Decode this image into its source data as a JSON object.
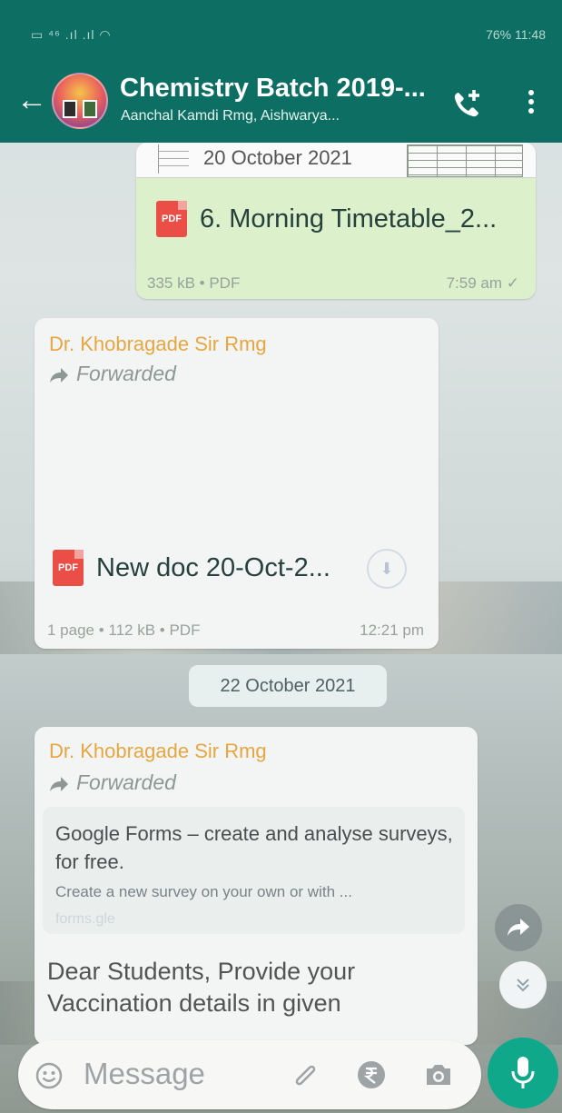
{
  "status_bar": {
    "left": "▭ ⁴⁶ .ıl .ıl ◠",
    "right": "76% 11:48"
  },
  "header": {
    "title": "Chemistry Batch 2019-...",
    "subtitle": "Aanchal Kamdi Rmg, Aishwarya..."
  },
  "messages": [
    {
      "type": "document",
      "direction": "outgoing",
      "thumbnail_text": "20 October 2021",
      "file_icon": "PDF",
      "file_name": "6. Morning Timetable_2...",
      "meta": "335 kB • PDF",
      "time": "7:59 am ✓"
    },
    {
      "type": "document",
      "direction": "incoming",
      "sender": "Dr. Khobragade Sir Rmg",
      "forwarded_label": "Forwarded",
      "file_icon": "PDF",
      "file_name": "New doc 20-Oct-2...",
      "meta": "1 page • 112 kB • PDF",
      "time": "12:21 pm"
    },
    {
      "type": "link",
      "direction": "incoming",
      "sender": "Dr. Khobragade Sir Rmg",
      "forwarded_label": "Forwarded",
      "preview_title": "Google Forms – create and analyse surveys, for free.",
      "preview_description": "Create a new survey on your own or with ...",
      "preview_url": "forms.gle",
      "text": "Dear Students, Provide your Vaccination details in given"
    }
  ],
  "date_separator": "22 October 2021",
  "composer": {
    "placeholder": "Message"
  },
  "colors": {
    "header": "#0d6f63",
    "outgoing_bubble": "#dcf0cb",
    "incoming_bubble": "#f3f5f4",
    "sender_name": "#e6a641",
    "mic_button": "#10a88b",
    "pdf_badge": "#ea4e46"
  },
  "icons": {
    "back": "back-arrow-icon",
    "call_add": "add-call-icon",
    "menu": "more-vert-icon",
    "forward": "forward-arrow-icon",
    "download": "download-icon",
    "share": "share-icon",
    "scroll_down": "double-chevron-down-icon",
    "emoji": "emoji-icon",
    "attach": "paperclip-icon",
    "payment": "rupee-icon",
    "camera": "camera-icon",
    "mic": "microphone-icon"
  }
}
